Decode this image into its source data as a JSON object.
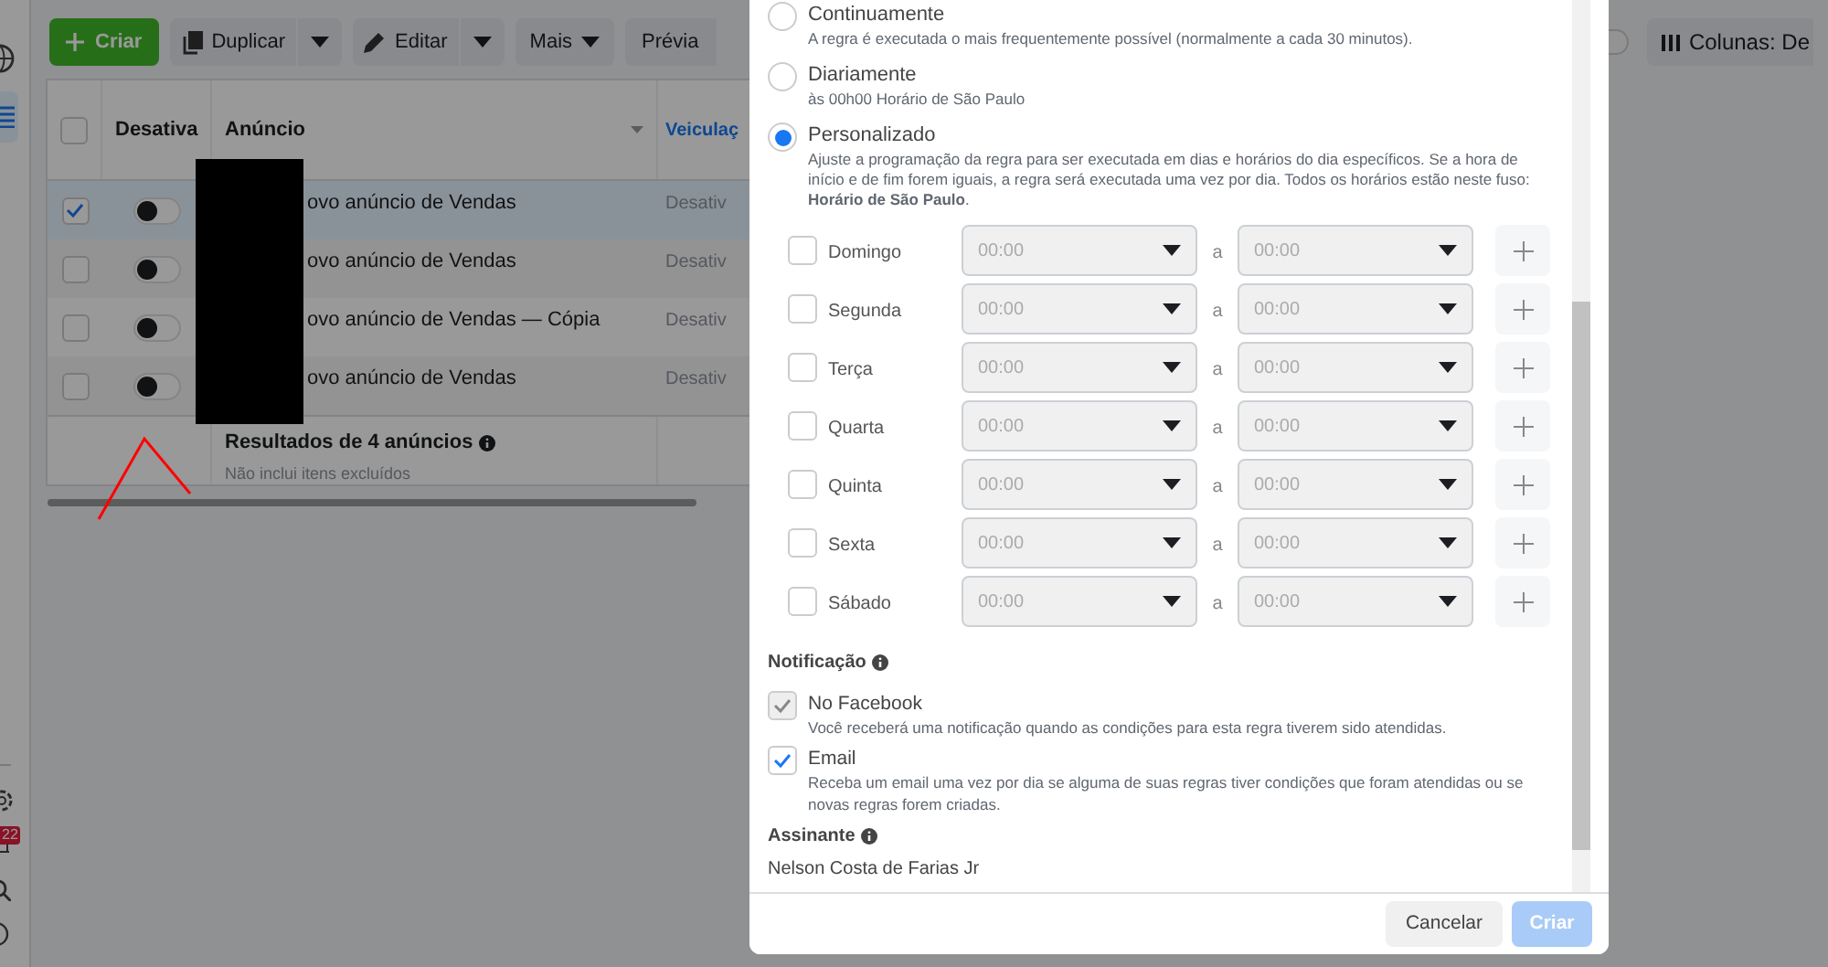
{
  "sidebar": {
    "badge": "22"
  },
  "toolbar": {
    "buttons": [
      {
        "kind": "primary",
        "label": "Criar"
      },
      {
        "kind": "split",
        "label": "Duplicar"
      },
      {
        "kind": "split",
        "label": "Editar"
      },
      {
        "kind": "menu",
        "label": "Mais"
      },
      {
        "kind": "plain",
        "label": "Prévia"
      }
    ]
  },
  "toolbar_right": {
    "toggle_on": false,
    "columns_button": "Colunas: De"
  },
  "table": {
    "all_selected": false,
    "columns": [
      "Desativa",
      "Anúncio",
      "Veiculaç"
    ],
    "rows": [
      {
        "selected": true,
        "on": false,
        "name": "ovo anúncio de Vendas",
        "delivery": "Desativ"
      },
      {
        "selected": false,
        "on": false,
        "name": "ovo anúncio de Vendas",
        "delivery": "Desativ"
      },
      {
        "selected": false,
        "on": false,
        "name": "ovo anúncio de Vendas — Cópia",
        "delivery": "Desativ"
      },
      {
        "selected": false,
        "on": false,
        "name": "ovo anúncio de Vendas",
        "delivery": "Desativ"
      }
    ],
    "summary": {
      "title": "Resultados de 4 anúncios",
      "subtitle": "Não inclui itens excluídos"
    }
  },
  "modal": {
    "schedule_options": [
      {
        "label": "Continuamente",
        "description": "A regra é executada o mais frequentemente possível (normalmente a cada 30 minutos).",
        "selected": false
      },
      {
        "label": "Diariamente",
        "description": "às 00h00 Horário de São Paulo",
        "selected": false
      },
      {
        "label": "Personalizado",
        "description": "Ajuste a programação da regra para ser executada em dias e horários do dia específicos. Se a hora de início e de fim forem iguais, a regra será executada uma vez por dia. Todos os horários estão neste fuso: **Horário de São Paulo**.",
        "selected": true
      }
    ],
    "days": [
      {
        "label": "Domingo",
        "checked": false,
        "from": "00:00",
        "separator": "a",
        "to": "00:00"
      },
      {
        "label": "Segunda",
        "checked": false,
        "from": "00:00",
        "separator": "a",
        "to": "00:00"
      },
      {
        "label": "Terça",
        "checked": false,
        "from": "00:00",
        "separator": "a",
        "to": "00:00"
      },
      {
        "label": "Quarta",
        "checked": false,
        "from": "00:00",
        "separator": "a",
        "to": "00:00"
      },
      {
        "label": "Quinta",
        "checked": false,
        "from": "00:00",
        "separator": "a",
        "to": "00:00"
      },
      {
        "label": "Sexta",
        "checked": false,
        "from": "00:00",
        "separator": "a",
        "to": "00:00"
      },
      {
        "label": "Sábado",
        "checked": false,
        "from": "00:00",
        "separator": "a",
        "to": "00:00"
      }
    ],
    "notification": {
      "title": "Notificação",
      "options": [
        {
          "label": "No Facebook",
          "description": "Você receberá uma notificação quando as condições para esta regra tiverem sido atendidas.",
          "checked": true,
          "disabled": true
        },
        {
          "label": "Email",
          "description": "Receba um email uma vez por dia se alguma de suas regras tiver condições que foram atendidas ou se novas regras forem criadas.",
          "checked": true,
          "disabled": false
        }
      ]
    },
    "subscriber": {
      "title": "Assinante",
      "value": "Nelson Costa de Farias Jr"
    },
    "footer": {
      "cancel": "Cancelar",
      "create": "Criar",
      "create_disabled": true
    }
  }
}
